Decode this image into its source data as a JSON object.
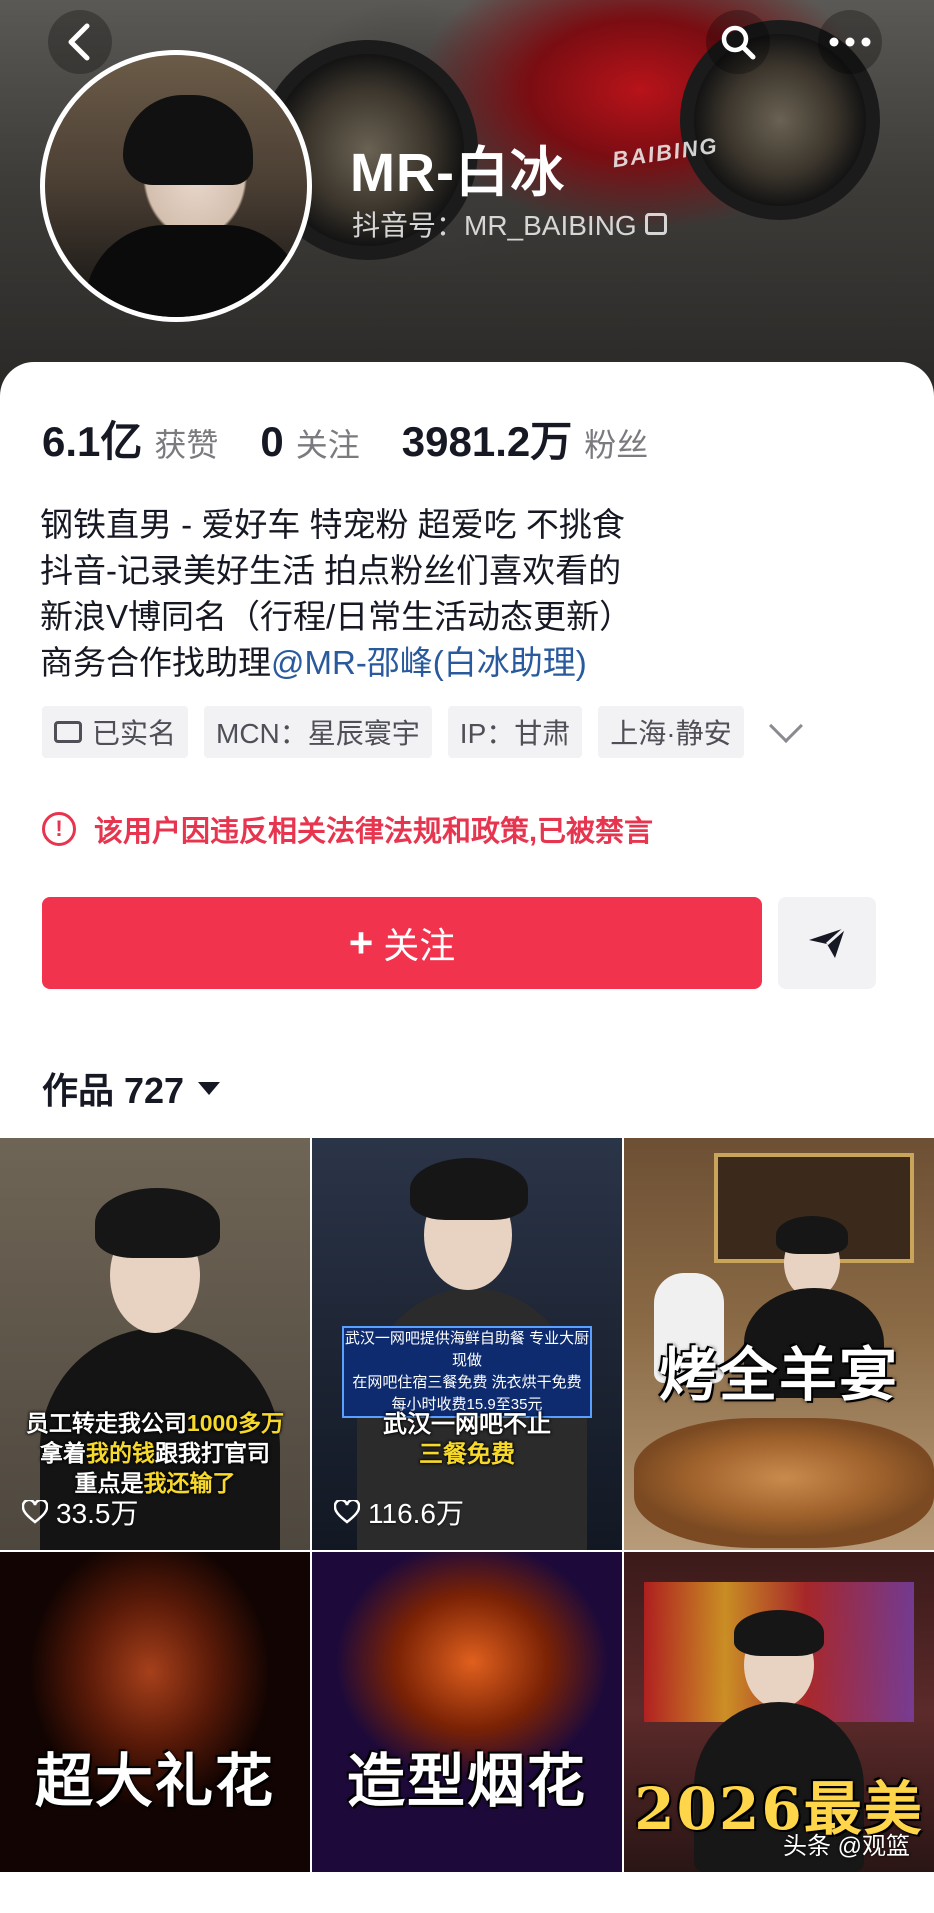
{
  "profile": {
    "nickname": "MR-白冰",
    "douyin_id": "抖音号：MR_BAIBING"
  },
  "banner": {
    "bike_text": "BAIBING"
  },
  "stats": [
    {
      "value": "6.1亿",
      "label": "获赞"
    },
    {
      "value": "0",
      "label": "关注"
    },
    {
      "value": "3981.2万",
      "label": "粉丝"
    }
  ],
  "bio": {
    "line1": "钢铁直男 - 爱好车 特宠粉 超爱吃 不挑食",
    "line2": "抖音-记录美好生活 拍点粉丝们喜欢看的",
    "line3": "新浪V博同名（行程/日常生活动态更新）",
    "line4_prefix": "商务合作找助理",
    "line4_mention": "@MR-邵峰(白冰助理)"
  },
  "tags": [
    {
      "label": "已实名",
      "icon": "id-card-icon"
    },
    {
      "label": "MCN：星辰寰宇"
    },
    {
      "label": "IP：甘肃"
    },
    {
      "label": "上海·静安"
    }
  ],
  "ban_notice": "该用户因违反相关法律法规和政策,已被禁言",
  "actions": {
    "follow_label": "关注",
    "follow_plus": "+"
  },
  "works": {
    "label": "作品 727"
  },
  "videos": [
    {
      "caption_line1_a": "员工转走我公司",
      "caption_line1_b": "1000多万",
      "caption_line2_a": "拿着",
      "caption_line2_b": "我的钱",
      "caption_line2_c": "跟我打官司",
      "caption_line3_a": "重点是",
      "caption_line3_b": "我还输了",
      "likes": "33.5万"
    },
    {
      "banner_line1": "武汉一网吧提供海鲜自助餐 专业大厨现做",
      "banner_line2": "在网吧住宿三餐免费 洗衣烘干免费",
      "banner_line3": "每小时收费15.9至35元",
      "caption_line1": "武汉一网吧不止",
      "caption_line2": "三餐免费",
      "likes": "116.6万"
    },
    {
      "caption": "烤全羊宴"
    },
    {
      "caption": "超大礼花"
    },
    {
      "caption": "造型烟花"
    },
    {
      "caption": "2026最美"
    }
  ],
  "watermark": "头条 @观篮",
  "colors": {
    "accent": "#f2334d",
    "ban_red": "#e8354f",
    "mention_blue": "#2a5a9e"
  }
}
